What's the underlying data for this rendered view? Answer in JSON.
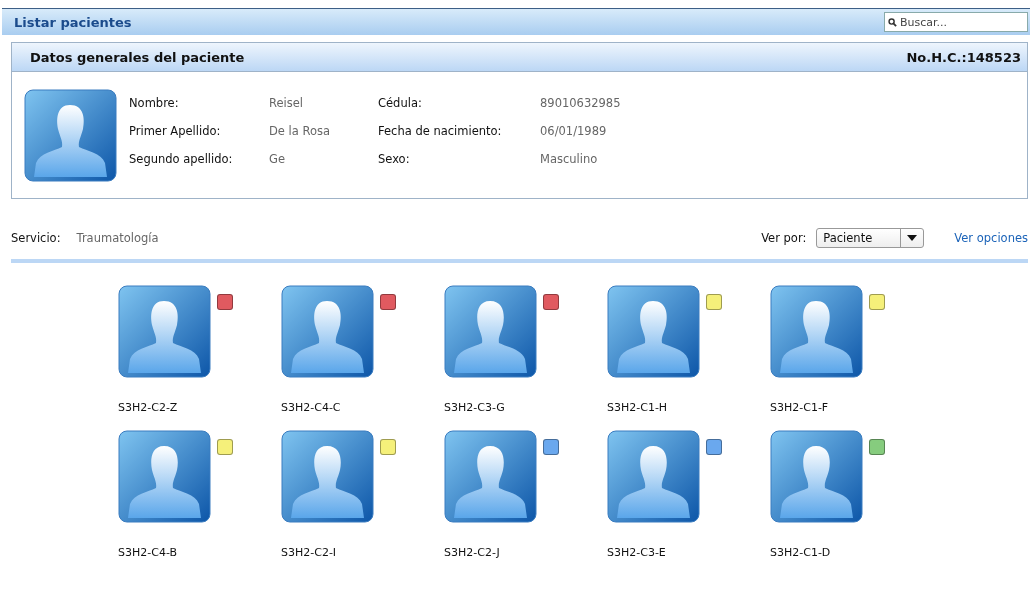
{
  "top_bar": {
    "title": "Listar pacientes",
    "search": {
      "placeholder": "Buscar..."
    }
  },
  "patient_panel": {
    "title": "Datos generales del paciente",
    "record_number": "No.H.C.:148523",
    "fields": [
      {
        "label": "Nombre:",
        "value": "Reisel"
      },
      {
        "label": "Cédula:",
        "value": "89010632985"
      },
      {
        "label": "Primer Apellido:",
        "value": "De la Rosa"
      },
      {
        "label": "Fecha de nacimiento:",
        "value": "06/01/1989"
      },
      {
        "label": "Segundo apellido:",
        "value": "Ge"
      },
      {
        "label": "Sexo:",
        "value": "Masculino"
      }
    ]
  },
  "service": {
    "label": "Servicio:",
    "value": "Traumatología"
  },
  "view_by": {
    "label": "Ver por:",
    "value": "Paciente"
  },
  "options_link": "Ver opciones",
  "beds": [
    {
      "name": "S3H2-C2-Z",
      "color": "#e05a60"
    },
    {
      "name": "S3H2-C4-C",
      "color": "#e05a60"
    },
    {
      "name": "S3H2-C3-G",
      "color": "#e05a60"
    },
    {
      "name": "S3H2-C1-H",
      "color": "#f5f07a"
    },
    {
      "name": "S3H2-C1-F",
      "color": "#f5f07a"
    },
    {
      "name": "S3H2-C4-B",
      "color": "#f5f07a"
    },
    {
      "name": "S3H2-C2-I",
      "color": "#f5f07a"
    },
    {
      "name": "S3H2-C2-J",
      "color": "#6aa8ee"
    },
    {
      "name": "S3H2-C3-E",
      "color": "#6aa8ee"
    },
    {
      "name": "S3H2-C1-D",
      "color": "#86cc7e"
    }
  ]
}
